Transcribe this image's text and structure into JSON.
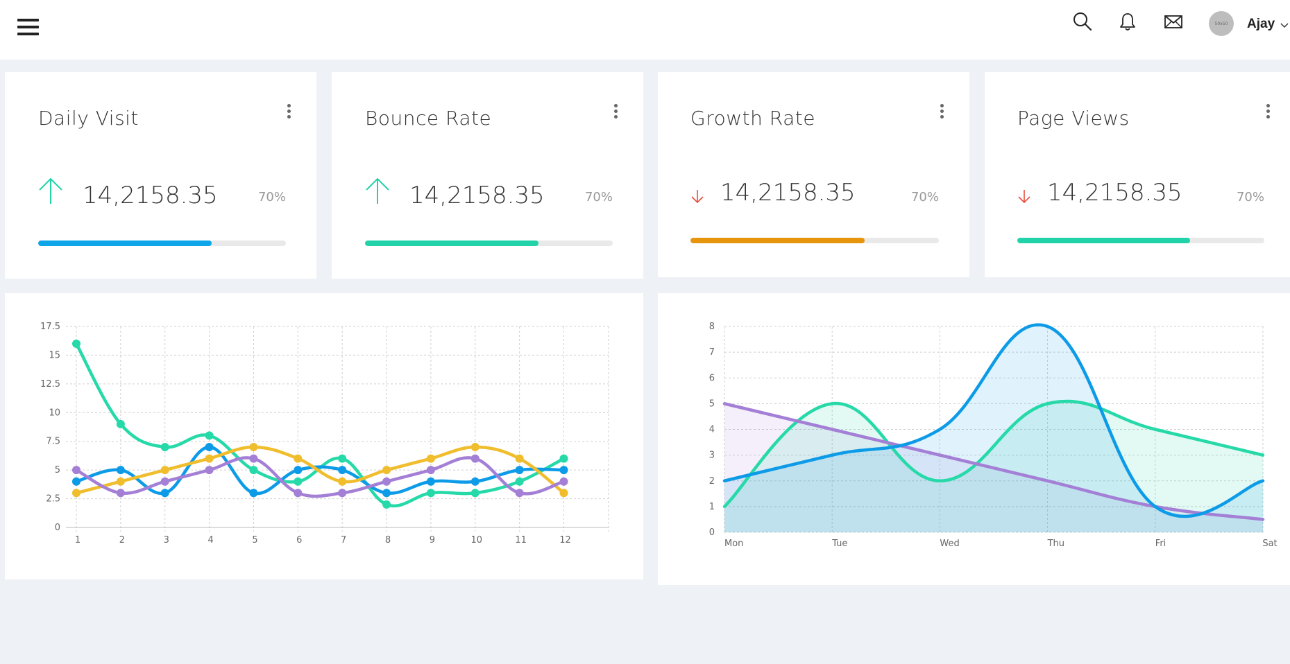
{
  "header": {
    "username": "Ajay",
    "avatar_text": "50x50",
    "icons": [
      "menu-icon",
      "search-icon",
      "bell-icon",
      "mail-icon",
      "chevron-down-icon"
    ]
  },
  "cards": [
    {
      "title": "Daily Visit",
      "value": "14,2158.35",
      "percent": "70%",
      "progress": 0.7,
      "trend": "up",
      "color": "#0ea5e9",
      "arrow_color": "#22d3aa"
    },
    {
      "title": "Bounce Rate",
      "value": "14,2158.35",
      "percent": "70%",
      "progress": 0.7,
      "trend": "up",
      "color": "#22d3aa",
      "arrow_color": "#22d3aa"
    },
    {
      "title": "Growth Rate",
      "value": "14,2158.35",
      "percent": "70%",
      "progress": 0.7,
      "trend": "down",
      "color": "#e8950e",
      "arrow_color": "#e74c3c"
    },
    {
      "title": "Page Views",
      "value": "14,2158.35",
      "percent": "70%",
      "progress": 0.7,
      "trend": "down",
      "color": "#22d3aa",
      "arrow_color": "#e74c3c"
    }
  ],
  "chart_data": [
    {
      "type": "line",
      "x": [
        1,
        2,
        3,
        4,
        5,
        6,
        7,
        8,
        9,
        10,
        11,
        12
      ],
      "yticks": [
        "0",
        "2.5",
        "5",
        "7.5",
        "10",
        "12.5",
        "15",
        "17.5"
      ],
      "ylim": [
        0,
        17.5
      ],
      "grid": true,
      "series": [
        {
          "color": "#25d9a8",
          "values": [
            16,
            9,
            7,
            8,
            5,
            4,
            6,
            2,
            3,
            3,
            4,
            6
          ]
        },
        {
          "color": "#0d9be8",
          "values": [
            4,
            5,
            3,
            7,
            3,
            5,
            5,
            3,
            4,
            4,
            5,
            5
          ]
        },
        {
          "color": "#f0bd2d",
          "values": [
            3,
            4,
            5,
            6,
            7,
            6,
            4,
            5,
            6,
            7,
            6,
            3
          ]
        },
        {
          "color": "#a47fd6",
          "values": [
            5,
            3,
            4,
            5,
            6,
            3,
            3,
            4,
            5,
            6,
            3,
            4
          ]
        }
      ]
    },
    {
      "type": "area",
      "categories": [
        "Mon",
        "Tue",
        "Wed",
        "Thu",
        "Fri",
        "Sat"
      ],
      "yticks": [
        "0",
        "1",
        "2",
        "3",
        "4",
        "5",
        "6",
        "7",
        "8"
      ],
      "ylim": [
        0,
        8
      ],
      "grid": true,
      "series": [
        {
          "color": "#0d9be8",
          "values": [
            2,
            3,
            4,
            8,
            1,
            2
          ]
        },
        {
          "color": "#25d9a8",
          "values": [
            1,
            5,
            2,
            5,
            4,
            3
          ]
        },
        {
          "color": "#a47fd6",
          "values": [
            5,
            4,
            3,
            2,
            1,
            0.5
          ]
        }
      ]
    }
  ]
}
